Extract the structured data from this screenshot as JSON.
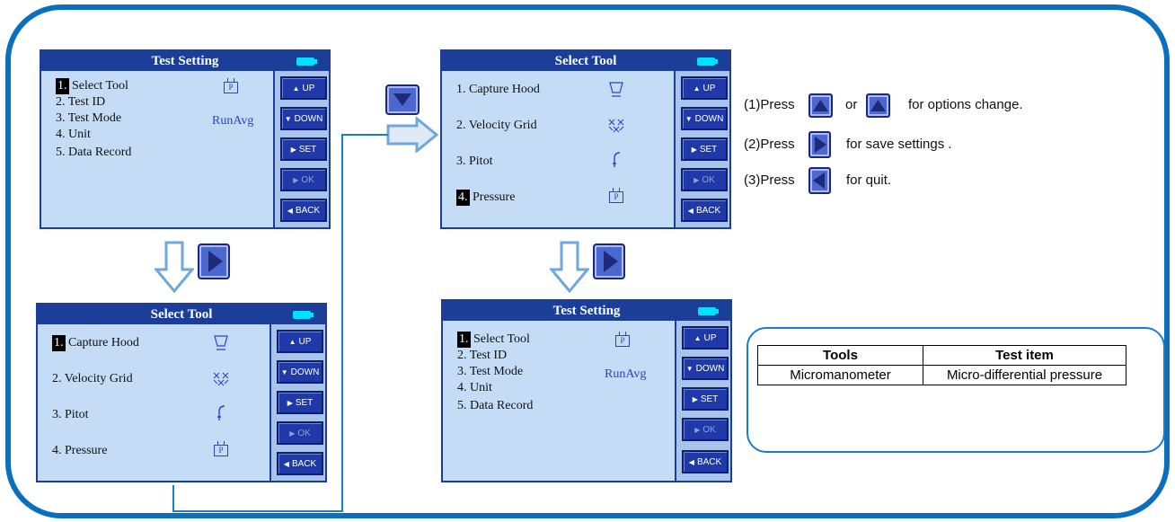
{
  "colors": {
    "frame": "#0a6fbf",
    "screen_title_bg": "#1b3f99",
    "screen_bg": "#c4dcf6",
    "button_bg": "#1f3aa8",
    "value_text": "#2a44c8"
  },
  "screens": {
    "test_setting_1": {
      "title": "Test Setting",
      "items": [
        {
          "num": "1.",
          "label": "Select Tool"
        },
        {
          "num": "2.",
          "label": "Test ID"
        },
        {
          "num": "3.",
          "label": "Test Mode"
        },
        {
          "num": "4.",
          "label": "Unit"
        },
        {
          "num": "5.",
          "label": "Data Record"
        }
      ],
      "mode_value": "RunAvg",
      "icon": "P"
    },
    "select_tool_1": {
      "title": "Select Tool",
      "items": [
        {
          "num": "1.",
          "label": "Capture Hood"
        },
        {
          "num": "2.",
          "label": "Velocity Grid"
        },
        {
          "num": "3.",
          "label": "Pitot"
        },
        {
          "num": "4.",
          "label": "Pressure"
        }
      ],
      "icon": "P"
    },
    "select_tool_2": {
      "title": "Select Tool",
      "items": [
        {
          "num": "1.",
          "label": "Capture Hood"
        },
        {
          "num": "2.",
          "label": "Velocity Grid"
        },
        {
          "num": "3.",
          "label": "Pitot"
        },
        {
          "num": "4.",
          "label": "Pressure"
        }
      ],
      "icon": "P"
    },
    "test_setting_2": {
      "title": "Test Setting",
      "items": [
        {
          "num": "1.",
          "label": "Select Tool"
        },
        {
          "num": "2.",
          "label": "Test ID"
        },
        {
          "num": "3.",
          "label": "Test Mode"
        },
        {
          "num": "4.",
          "label": "Unit"
        },
        {
          "num": "5.",
          "label": "Data Record"
        }
      ],
      "mode_value": "RunAvg",
      "icon": "P"
    }
  },
  "sidebar_buttons": {
    "up": "UP",
    "down": "DOWN",
    "set": "SET",
    "ok": "OK",
    "back": "BACK"
  },
  "instructions": {
    "line1_prefix": "(1)Press",
    "line1_or": "or",
    "line1_suffix": "for options change.",
    "line2_prefix": "(2)Press",
    "line2_suffix": "for save settings .",
    "line3_prefix": "(3)Press",
    "line3_suffix": "for quit."
  },
  "table": {
    "headers": [
      "Tools",
      "Test item"
    ],
    "rows": [
      [
        "Micromanometer",
        "Micro-differential pressure"
      ]
    ]
  }
}
